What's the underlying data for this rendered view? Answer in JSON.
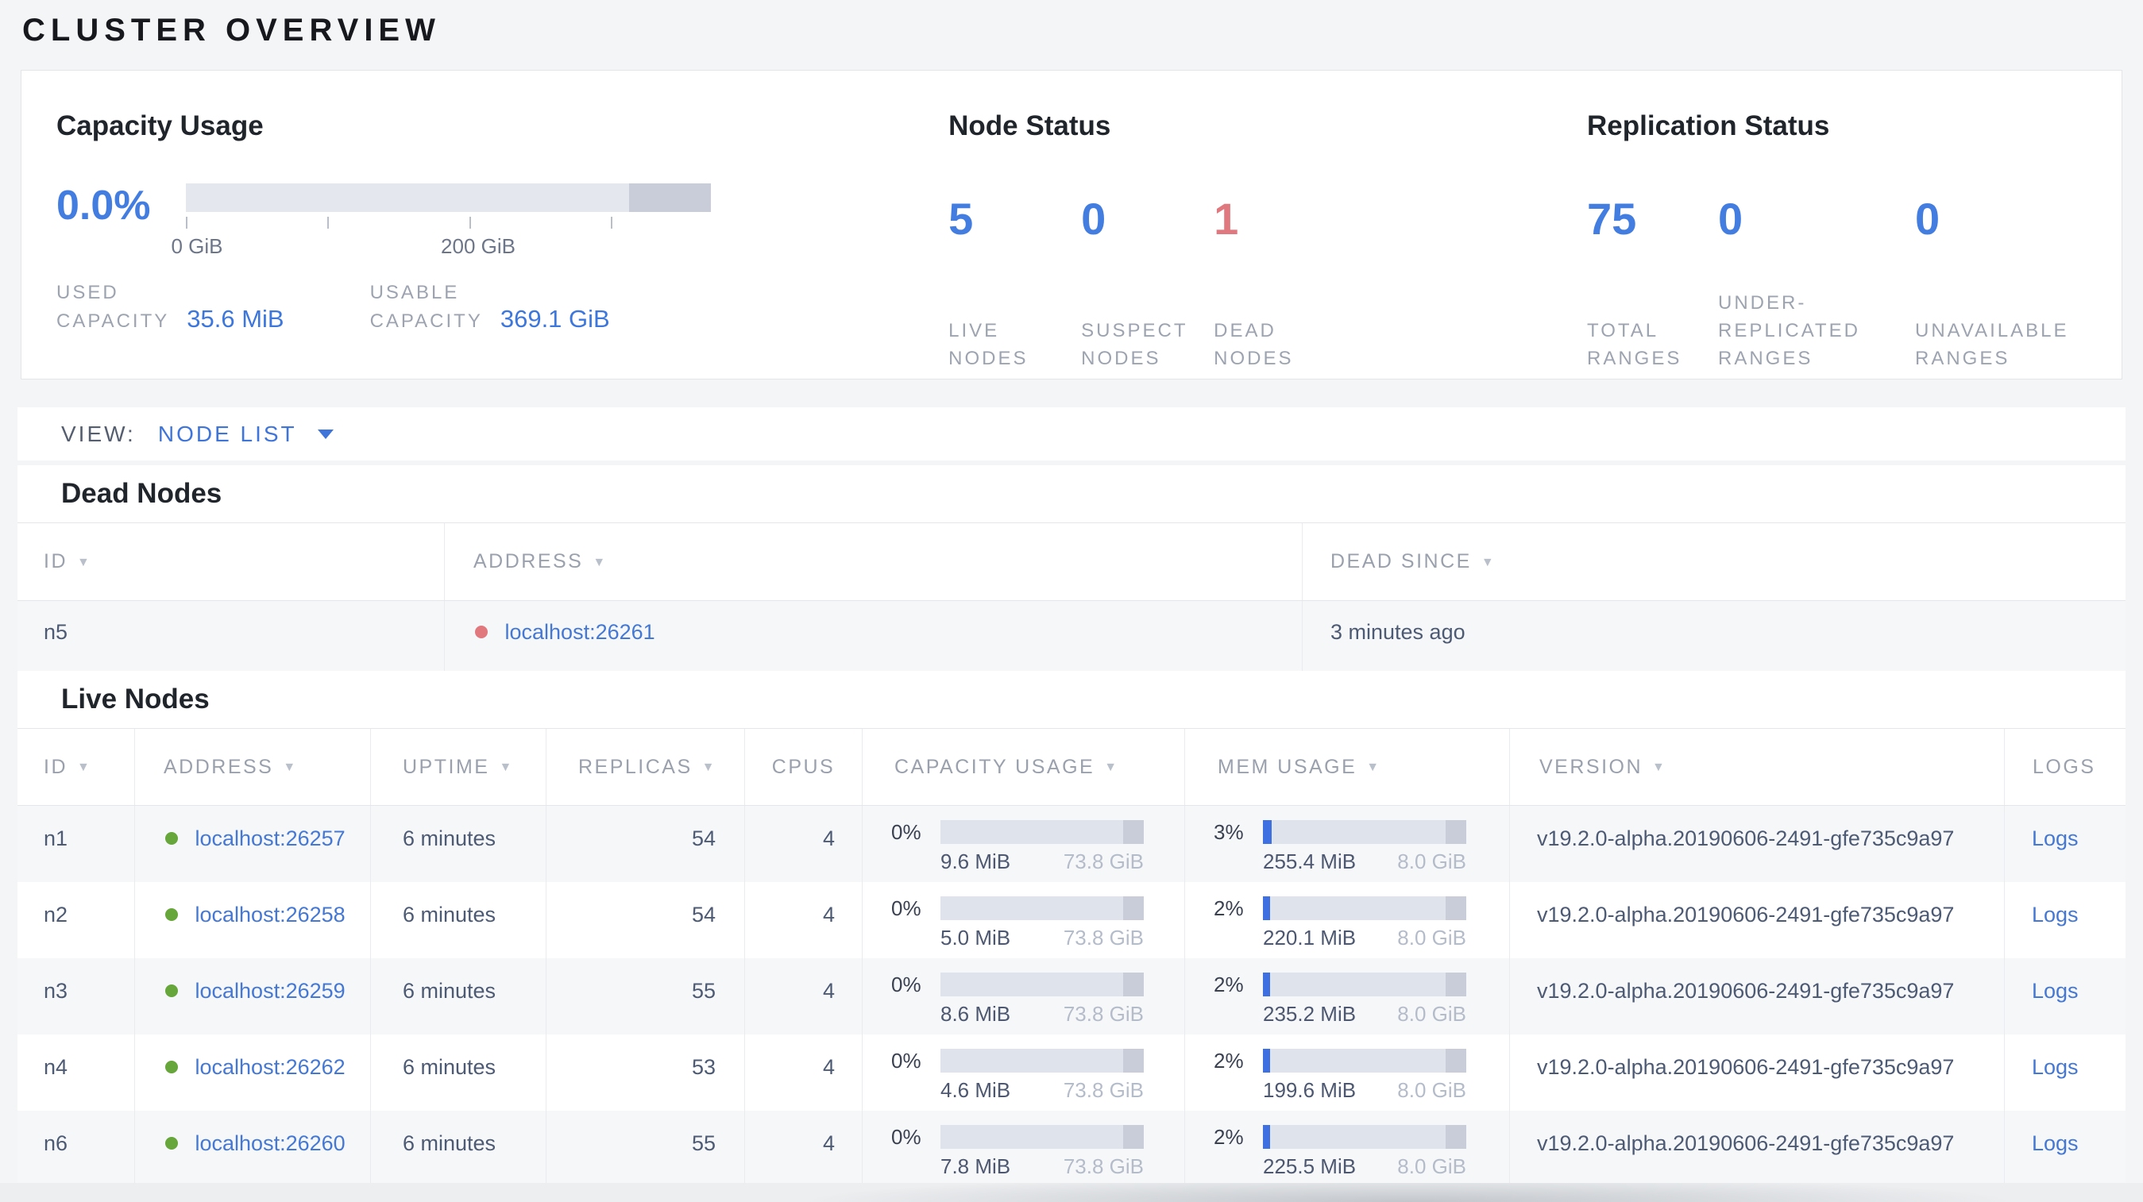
{
  "colors": {
    "accent_blue": "#437de0",
    "link_blue": "#4478d4",
    "danger_red": "#e0797f",
    "live_green": "#67a63b",
    "bar_track": "#dfe3ec",
    "bar_dark_segment": "#c8cdd9",
    "mem_fill_blue": "#3e70e2"
  },
  "icons": {
    "sort_desc": "▼"
  },
  "page_title": "CLUSTER OVERVIEW",
  "summary": {
    "capacity": {
      "title": "Capacity Usage",
      "percent": "0.0%",
      "tick_0": "0 GiB",
      "tick_200": "200 GiB",
      "stats": [
        {
          "label": "USED\nCAPACITY",
          "value": "35.6 MiB"
        },
        {
          "label": "USABLE\nCAPACITY",
          "value": "369.1 GiB"
        }
      ]
    },
    "node_status": {
      "title": "Node Status",
      "stats": [
        {
          "value": "5",
          "label": "LIVE\nNODES"
        },
        {
          "value": "0",
          "label": "SUSPECT\nNODES"
        },
        {
          "value": "1",
          "label": "DEAD\nNODES"
        }
      ]
    },
    "replication": {
      "title": "Replication Status",
      "stats": [
        {
          "value": "75",
          "label": "TOTAL\nRANGES"
        },
        {
          "value": "0",
          "label": "UNDER-\nREPLICATED\nRANGES"
        },
        {
          "value": "0",
          "label": "UNAVAILABLE\nRANGES"
        }
      ]
    }
  },
  "view_bar": {
    "label": "VIEW:",
    "selected": "NODE LIST"
  },
  "dead_nodes": {
    "title": "Dead Nodes",
    "columns": [
      "ID",
      "ADDRESS",
      "DEAD SINCE"
    ],
    "rows": [
      {
        "id": "n5",
        "address": "localhost:26261",
        "dead_since": "3 minutes ago"
      }
    ]
  },
  "live_nodes": {
    "title": "Live Nodes",
    "columns": [
      "ID",
      "ADDRESS",
      "UPTIME",
      "REPLICAS",
      "CPUS",
      "CAPACITY USAGE",
      "MEM USAGE",
      "VERSION",
      "LOGS"
    ],
    "rows": [
      {
        "id": "n1",
        "address": "localhost:26257",
        "uptime": "6 minutes",
        "replicas": "54",
        "cpus": "4",
        "capacity": {
          "percent": "0%",
          "used": "9.6 MiB",
          "total": "73.8 GiB",
          "fill_style": "width:0px"
        },
        "mem": {
          "percent": "3%",
          "used": "255.4 MiB",
          "total": "8.0 GiB",
          "fill_style": "width:11px"
        },
        "version": "v19.2.0-alpha.20190606-2491-gfe735c9a97",
        "logs": "Logs"
      },
      {
        "id": "n2",
        "address": "localhost:26258",
        "uptime": "6 minutes",
        "replicas": "54",
        "cpus": "4",
        "capacity": {
          "percent": "0%",
          "used": "5.0 MiB",
          "total": "73.8 GiB",
          "fill_style": "width:0px"
        },
        "mem": {
          "percent": "2%",
          "used": "220.1 MiB",
          "total": "8.0 GiB",
          "fill_style": "width:9px"
        },
        "version": "v19.2.0-alpha.20190606-2491-gfe735c9a97",
        "logs": "Logs"
      },
      {
        "id": "n3",
        "address": "localhost:26259",
        "uptime": "6 minutes",
        "replicas": "55",
        "cpus": "4",
        "capacity": {
          "percent": "0%",
          "used": "8.6 MiB",
          "total": "73.8 GiB",
          "fill_style": "width:0px"
        },
        "mem": {
          "percent": "2%",
          "used": "235.2 MiB",
          "total": "8.0 GiB",
          "fill_style": "width:9px"
        },
        "version": "v19.2.0-alpha.20190606-2491-gfe735c9a97",
        "logs": "Logs"
      },
      {
        "id": "n4",
        "address": "localhost:26262",
        "uptime": "6 minutes",
        "replicas": "53",
        "cpus": "4",
        "capacity": {
          "percent": "0%",
          "used": "4.6 MiB",
          "total": "73.8 GiB",
          "fill_style": "width:0px"
        },
        "mem": {
          "percent": "2%",
          "used": "199.6 MiB",
          "total": "8.0 GiB",
          "fill_style": "width:9px"
        },
        "version": "v19.2.0-alpha.20190606-2491-gfe735c9a97",
        "logs": "Logs"
      },
      {
        "id": "n6",
        "address": "localhost:26260",
        "uptime": "6 minutes",
        "replicas": "55",
        "cpus": "4",
        "capacity": {
          "percent": "0%",
          "used": "7.8 MiB",
          "total": "73.8 GiB",
          "fill_style": "width:0px"
        },
        "mem": {
          "percent": "2%",
          "used": "225.5 MiB",
          "total": "8.0 GiB",
          "fill_style": "width:9px"
        },
        "version": "v19.2.0-alpha.20190606-2491-gfe735c9a97",
        "logs": "Logs"
      }
    ]
  }
}
